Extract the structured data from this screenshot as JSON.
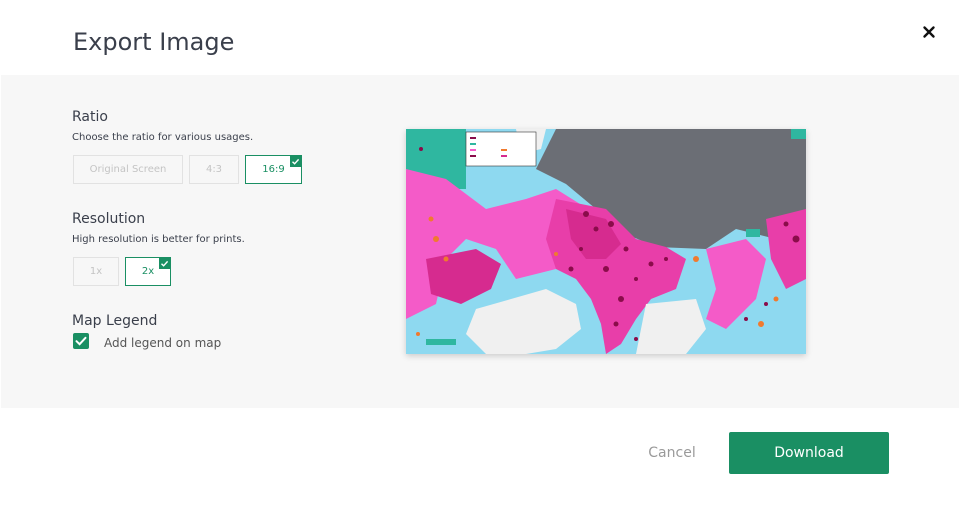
{
  "dialog": {
    "title": "Export Image",
    "close_icon": "close-icon"
  },
  "ratio": {
    "title": "Ratio",
    "description": "Choose the ratio for various usages.",
    "options": [
      "Original Screen",
      "4:3",
      "16:9"
    ],
    "selected": "16:9"
  },
  "resolution": {
    "title": "Resolution",
    "description": "High resolution is better for prints.",
    "options": [
      "1x",
      "2x"
    ],
    "selected": "2x"
  },
  "legend": {
    "title": "Map Legend",
    "checkbox_label": "Add legend on map",
    "checked": true
  },
  "footer": {
    "cancel_label": "Cancel",
    "download_label": "Download"
  },
  "colors": {
    "accent": "#1a8f63",
    "map_land": "#f0f0f0",
    "map_mountains": "#6b6e75",
    "map_water_light": "#8ed9f0",
    "map_pink": "#f45bc8",
    "map_magenta": "#d62b8f",
    "map_dark_points": "#8a0c4a",
    "map_orange": "#f07a2e"
  }
}
